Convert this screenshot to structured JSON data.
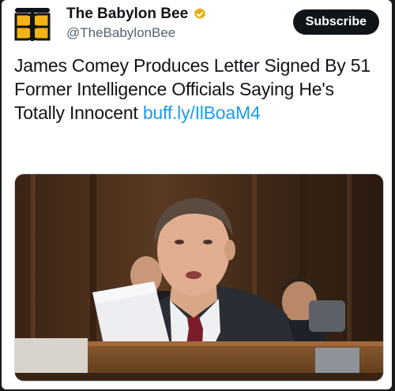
{
  "account": {
    "display_name": "The Babylon Bee",
    "handle": "@TheBabylonBee",
    "verified_icon": "gold-verified-badge-icon",
    "logo_icon": "babylon-bee-logo-icon"
  },
  "subscribe": {
    "label": "Subscribe"
  },
  "tweet": {
    "text": "James Comey Produces Letter Signed By 51 Former Intelligence Officials Saying He's Totally Innocent",
    "link_text": "buff.ly/IlBoaM4"
  },
  "media": {
    "description_icon": "photo-man-holding-paper-icon"
  },
  "colors": {
    "brand_gold": "#f2b417",
    "link": "#1d9bf0",
    "subscribe_bg": "#0f1419"
  }
}
